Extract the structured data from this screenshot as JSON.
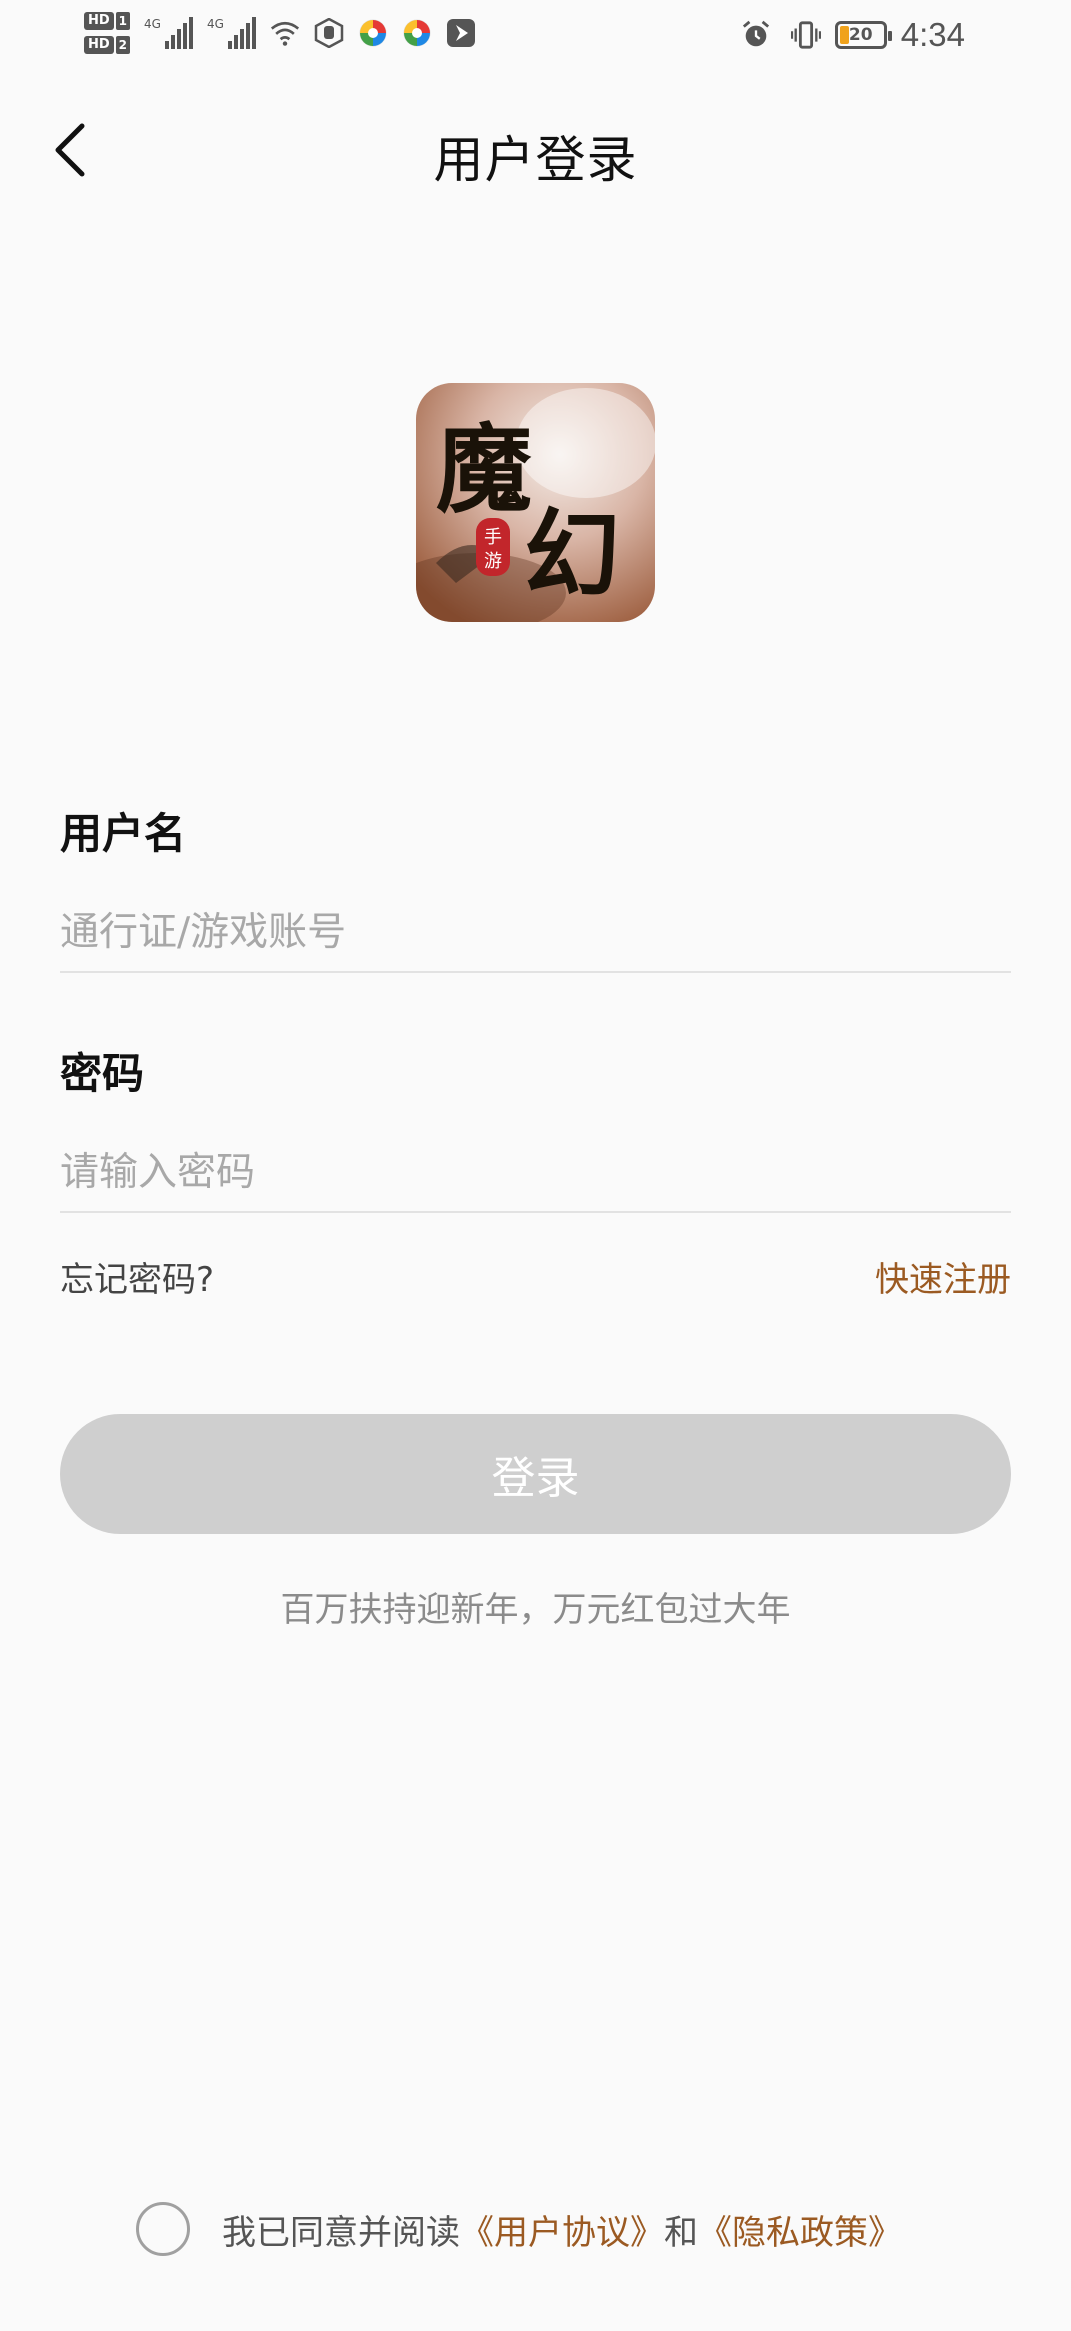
{
  "status_bar": {
    "sim1": "HD",
    "sim1_slot": "1",
    "sim2": "HD",
    "sim2_slot": "2",
    "net1": "4G",
    "net2": "4G",
    "battery": "20",
    "time": "4:34"
  },
  "header": {
    "title": "用户登录"
  },
  "logo": {
    "main_text": "魔幻",
    "seal_text": "手游"
  },
  "form": {
    "username_label": "用户名",
    "username_placeholder": "通行证/游戏账号",
    "password_label": "密码",
    "password_placeholder": "请输入密码",
    "forgot_label": "忘记密码?",
    "register_label": "快速注册",
    "login_label": "登录"
  },
  "promo": "百万扶持迎新年，万元红包过大年",
  "agreement": {
    "prefix": "我已同意并阅读",
    "user_agreement": "《用户协议》",
    "conjunction": "和",
    "privacy_policy": "《隐私政策》"
  },
  "colors": {
    "accent": "#9b5a22",
    "button_disabled": "#cfcfcf",
    "battery_fill": "#f0a21b"
  }
}
